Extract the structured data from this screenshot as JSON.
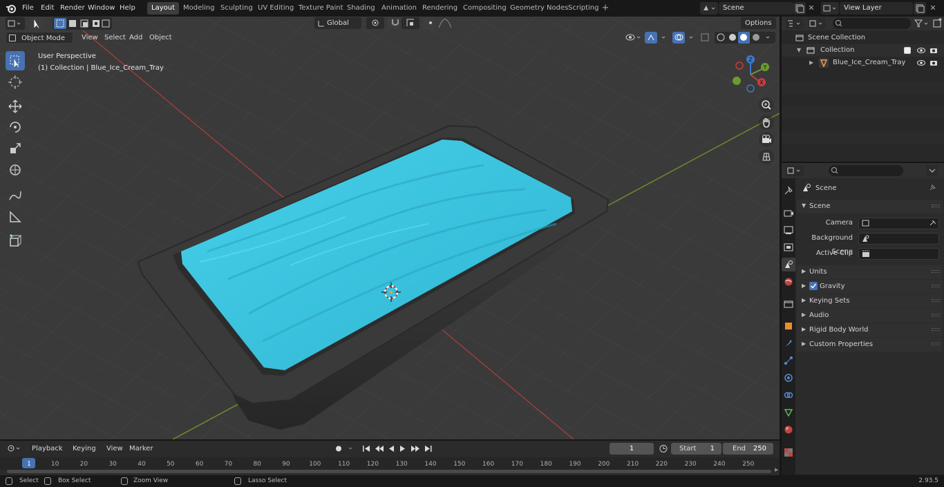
{
  "menu": [
    "File",
    "Edit",
    "Render",
    "Window",
    "Help"
  ],
  "workspaces": [
    "Layout",
    "Modeling",
    "Sculpting",
    "UV Editing",
    "Texture Paint",
    "Shading",
    "Animation",
    "Rendering",
    "Compositing",
    "Geometry Nodes",
    "Scripting"
  ],
  "scene_name": "Scene",
  "view_layer": "View Layer",
  "viewport": {
    "mode": "Object Mode",
    "menus": [
      "View",
      "Select",
      "Add",
      "Object"
    ],
    "transform_orientation": "Global",
    "options_label": "Options",
    "perspective_label": "User Perspective",
    "collection_label": "(1) Collection | Blue_Ice_Cream_Tray",
    "gizmo_axes": {
      "x": "X",
      "y": "Y",
      "z": "Z"
    }
  },
  "outliner": {
    "root": "Scene Collection",
    "collection": "Collection",
    "object": "Blue_Ice_Cream_Tray"
  },
  "properties": {
    "context": "Scene",
    "section": "Scene",
    "fields": [
      {
        "label": "Camera"
      },
      {
        "label": "Background Scene"
      },
      {
        "label": "Active Clip"
      }
    ],
    "panels": [
      "Units",
      "Gravity",
      "Keying Sets",
      "Audio",
      "Rigid Body World",
      "Custom Properties"
    ]
  },
  "timeline": {
    "menus": [
      "Playback",
      "Keying",
      "View",
      "Marker"
    ],
    "current_frame": "1",
    "start_label": "Start",
    "start": "1",
    "end_label": "End",
    "end": "250",
    "ticks": [
      "1",
      "10",
      "20",
      "30",
      "40",
      "50",
      "60",
      "70",
      "80",
      "90",
      "100",
      "110",
      "120",
      "130",
      "140",
      "150",
      "160",
      "170",
      "180",
      "190",
      "200",
      "210",
      "220",
      "230",
      "240",
      "250"
    ]
  },
  "status": {
    "select": "Select",
    "box_select": "Box Select",
    "zoom_view": "Zoom View",
    "lasso_select": "Lasso Select",
    "version": "2.93.5"
  },
  "colors": {
    "accent": "#4772b3",
    "ice_cream": "#3cc4de",
    "tray": "#353535",
    "grid": "#444444",
    "x_axis": "#9e3c3c",
    "y_axis": "#6b8d2a"
  }
}
